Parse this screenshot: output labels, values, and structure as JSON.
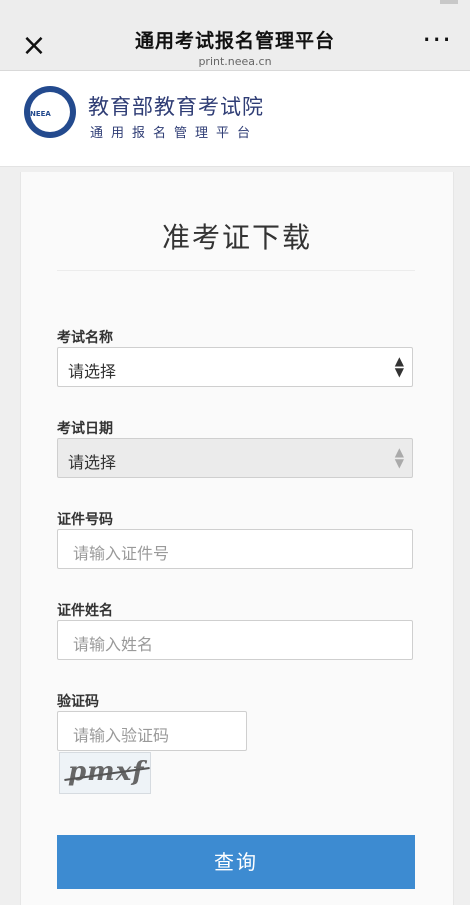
{
  "topbar": {
    "title": "通用考试报名管理平台",
    "subtitle": "print.neea.cn",
    "close_icon": "×",
    "more_icon": "···"
  },
  "header": {
    "org_name": "教育部教育考试院",
    "org_subtitle": "通用报名管理平台",
    "logo_text": "NEEA"
  },
  "form": {
    "title": "准考证下载",
    "exam_name": {
      "label": "考试名称",
      "value": "请选择"
    },
    "exam_date": {
      "label": "考试日期",
      "value": "请选择"
    },
    "id_number": {
      "label": "证件号码",
      "placeholder": "请输入证件号"
    },
    "id_name": {
      "label": "证件姓名",
      "placeholder": "请输入姓名"
    },
    "captcha": {
      "label": "验证码",
      "placeholder": "请输入验证码",
      "image_text": "pmxf"
    },
    "submit_label": "查询"
  },
  "colors": {
    "accent": "#3d8bd1",
    "brand": "#2f3d75"
  }
}
